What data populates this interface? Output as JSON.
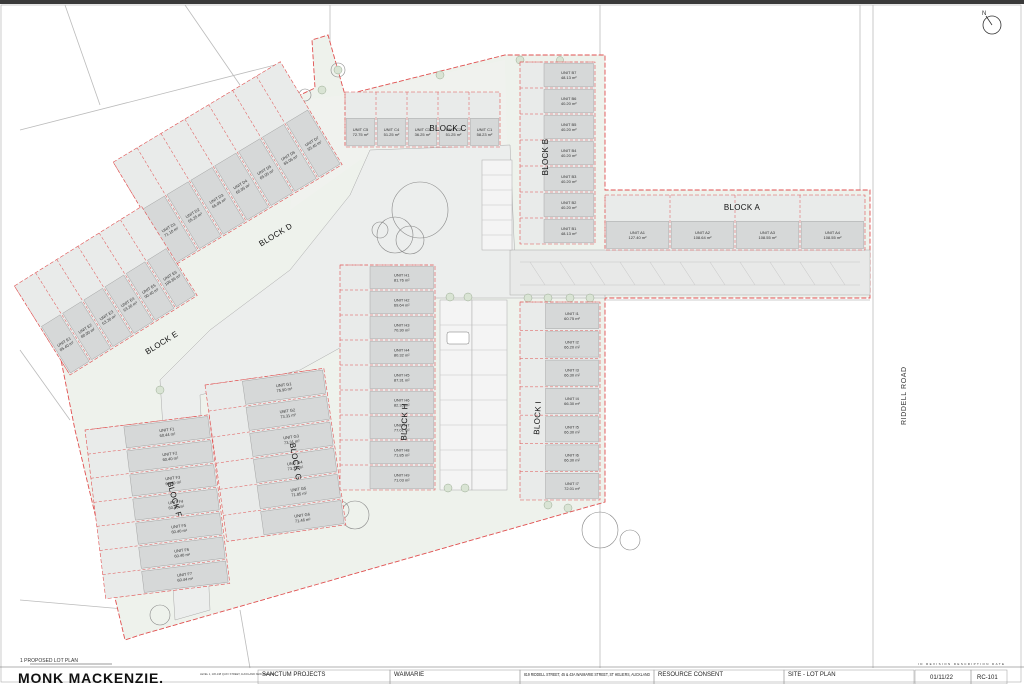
{
  "drawing": {
    "title": "1  PROPOSED LOT PLAN",
    "north_label": "N",
    "road_label": "RIDDELL ROAD"
  },
  "blocks": [
    {
      "id": "A",
      "label": "BLOCK A"
    },
    {
      "id": "B",
      "label": "BLOCK B"
    },
    {
      "id": "C",
      "label": "BLOCK C"
    },
    {
      "id": "D",
      "label": "BLOCK D"
    },
    {
      "id": "E",
      "label": "BLOCK E"
    },
    {
      "id": "F",
      "label": "BLOCK F"
    },
    {
      "id": "G",
      "label": "BLOCK G"
    },
    {
      "id": "H",
      "label": "BLOCK H"
    },
    {
      "id": "I",
      "label": "BLOCK I"
    }
  ],
  "units": {
    "A": [
      {
        "label": "UNIT A4",
        "area": "108.55 m²"
      },
      {
        "label": "UNIT A3",
        "area": "108.55 m²"
      },
      {
        "label": "UNIT A2",
        "area": "108.64 m²"
      },
      {
        "label": "UNIT A1",
        "area": "127.40 m²"
      }
    ],
    "B": [
      {
        "label": "UNIT B7",
        "area": "48.13 m²"
      },
      {
        "label": "UNIT B6",
        "area": "40.20 m²"
      },
      {
        "label": "UNIT B5",
        "area": "40.20 m²"
      },
      {
        "label": "UNIT B4",
        "area": "40.20 m²"
      },
      {
        "label": "UNIT B3",
        "area": "40.20 m²"
      },
      {
        "label": "UNIT B2",
        "area": "40.20 m²"
      },
      {
        "label": "UNIT B1",
        "area": "48.13 m²"
      }
    ],
    "C": [
      {
        "label": "UNIT C5",
        "area": "72.75 m²"
      },
      {
        "label": "UNIT C4",
        "area": "51.25 m²"
      },
      {
        "label": "UNIT C3",
        "area": "36.25 m²"
      },
      {
        "label": "UNIT C2",
        "area": "51.25 m²"
      },
      {
        "label": "UNIT C1",
        "area": "58.23 m²"
      }
    ],
    "D": [
      {
        "label": "UNIT D1",
        "area": "71.10 m²"
      },
      {
        "label": "UNIT D2",
        "area": "65.25 m²"
      },
      {
        "label": "UNIT D3",
        "area": "65.05 m²"
      },
      {
        "label": "UNIT D4",
        "area": "65.05 m²"
      },
      {
        "label": "UNIT D5",
        "area": "65.05 m²"
      },
      {
        "label": "UNIT D6",
        "area": "65.05 m²"
      },
      {
        "label": "UNIT D7",
        "area": "55.45 m²"
      }
    ],
    "E": [
      {
        "label": "UNIT E1",
        "area": "85.40 m²"
      },
      {
        "label": "UNIT E2",
        "area": "80.00 m²"
      },
      {
        "label": "UNIT E3",
        "area": "63.20 m²"
      },
      {
        "label": "UNIT E4",
        "area": "63.20 m²"
      },
      {
        "label": "UNIT E5",
        "area": "90.40 m²"
      },
      {
        "label": "UNIT E6",
        "area": "106.86 m²"
      }
    ],
    "F": [
      {
        "label": "UNIT F1",
        "area": "60.44 m²"
      },
      {
        "label": "UNIT F2",
        "area": "60.40 m²"
      },
      {
        "label": "UNIT F3",
        "area": "60.40 m²"
      },
      {
        "label": "UNIT F4",
        "area": "60.40 m²"
      },
      {
        "label": "UNIT F5",
        "area": "60.40 m²"
      },
      {
        "label": "UNIT F6",
        "area": "60.40 m²"
      },
      {
        "label": "UNIT F7",
        "area": "60.44 m²"
      }
    ],
    "G": [
      {
        "label": "UNIT G1",
        "area": "75.90 m²"
      },
      {
        "label": "UNIT G2",
        "area": "73.31 m²"
      },
      {
        "label": "UNIT G3",
        "area": "73.31 m²"
      },
      {
        "label": "UNIT G4",
        "area": "73.31 m²"
      },
      {
        "label": "UNIT G5",
        "area": "71.85 m²"
      },
      {
        "label": "UNIT G6",
        "area": "71.46 m²"
      }
    ],
    "H": [
      {
        "label": "UNIT H1",
        "area": "81.76 m²"
      },
      {
        "label": "UNIT H2",
        "area": "69.64 m²"
      },
      {
        "label": "UNIT H3",
        "area": "70.30 m²"
      },
      {
        "label": "UNIT H4",
        "area": "80.32 m²"
      },
      {
        "label": "UNIT H5",
        "area": "87.31 m²"
      },
      {
        "label": "UNIT H6",
        "area": "82.35 m²"
      },
      {
        "label": "UNIT H7",
        "area": "77.01 m²"
      },
      {
        "label": "UNIT H8",
        "area": "71.85 m²"
      },
      {
        "label": "UNIT H9",
        "area": "71.03 m²"
      }
    ],
    "I": [
      {
        "label": "UNIT I1",
        "area": "60.75 m²"
      },
      {
        "label": "UNIT I2",
        "area": "66.20 m²"
      },
      {
        "label": "UNIT I3",
        "area": "66.30 m²"
      },
      {
        "label": "UNIT I4",
        "area": "66.30 m²"
      },
      {
        "label": "UNIT I5",
        "area": "66.30 m²"
      },
      {
        "label": "UNIT I6",
        "area": "66.30 m²"
      },
      {
        "label": "UNIT I7",
        "area": "72.01 m²"
      }
    ]
  },
  "title_block": {
    "firm": "MONK MACKENZIE.",
    "firm_address": "LEVEL 1, 136-138 QUAY STREET, AUCKLAND NEW ZEALAND",
    "client": "SANCTUM PROJECTS",
    "project": "WAIMARIE",
    "address": "819 RIDDELL STREET, 45 & 43A WAIMARIE STREET, ST HELIERS, AUCKLAND",
    "stage": "RESOURCE CONSENT",
    "sheet_title": "SITE - LOT PLAN",
    "rev_headers": "ID   REVISION DESCRIPTION   DATE",
    "date": "01/11/22",
    "sheet_no": "RC-101"
  }
}
